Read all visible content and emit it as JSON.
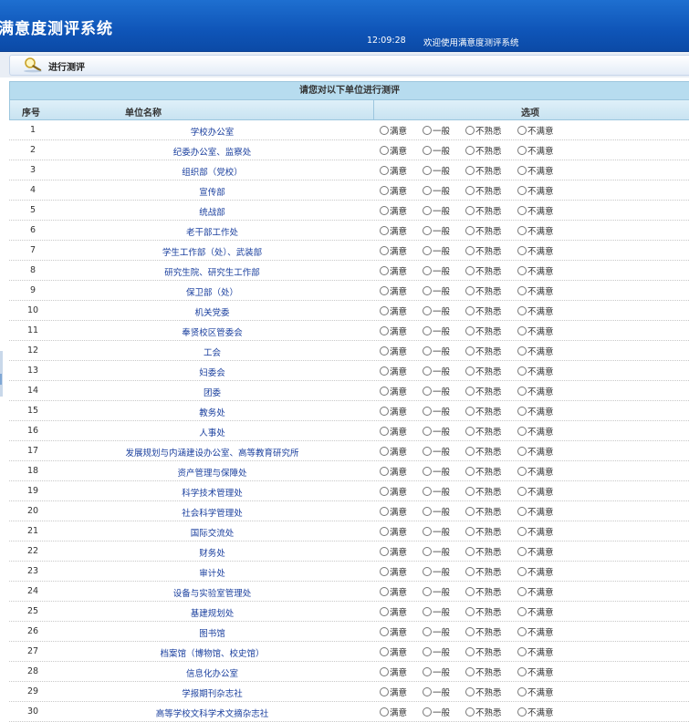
{
  "header": {
    "title": "满意度测评系统",
    "time": "12:09:28",
    "welcome": "欢迎使用满意度测评系统"
  },
  "tabbar": {
    "label": "进行测评",
    "icon": "magnifier-icon"
  },
  "table": {
    "caption": "请您对以下单位进行测评",
    "columns": {
      "seq": "序号",
      "name": "单位名称",
      "options": "选项"
    },
    "option_labels": [
      "满意",
      "一般",
      "不熟悉",
      "不满意"
    ],
    "rows": [
      {
        "seq": "1",
        "name": "学校办公室"
      },
      {
        "seq": "2",
        "name": "纪委办公室、监察处"
      },
      {
        "seq": "3",
        "name": "组织部（党校）"
      },
      {
        "seq": "4",
        "name": "宣传部"
      },
      {
        "seq": "5",
        "name": "统战部"
      },
      {
        "seq": "6",
        "name": "老干部工作处"
      },
      {
        "seq": "7",
        "name": "学生工作部（处）、武装部"
      },
      {
        "seq": "8",
        "name": "研究生院、研究生工作部"
      },
      {
        "seq": "9",
        "name": "保卫部（处）"
      },
      {
        "seq": "10",
        "name": "机关党委"
      },
      {
        "seq": "11",
        "name": "奉贤校区管委会"
      },
      {
        "seq": "12",
        "name": "工会"
      },
      {
        "seq": "13",
        "name": "妇委会"
      },
      {
        "seq": "14",
        "name": "团委"
      },
      {
        "seq": "15",
        "name": "教务处"
      },
      {
        "seq": "16",
        "name": "人事处"
      },
      {
        "seq": "17",
        "name": "发展规划与内涵建设办公室、高等教育研究所"
      },
      {
        "seq": "18",
        "name": "资产管理与保障处"
      },
      {
        "seq": "19",
        "name": "科学技术管理处"
      },
      {
        "seq": "20",
        "name": "社会科学管理处"
      },
      {
        "seq": "21",
        "name": "国际交流处"
      },
      {
        "seq": "22",
        "name": "财务处"
      },
      {
        "seq": "23",
        "name": "审计处"
      },
      {
        "seq": "24",
        "name": "设备与实验室管理处"
      },
      {
        "seq": "25",
        "name": "基建规划处"
      },
      {
        "seq": "26",
        "name": "图书馆"
      },
      {
        "seq": "27",
        "name": "档案馆（博物馆、校史馆）"
      },
      {
        "seq": "28",
        "name": "信息化办公室"
      },
      {
        "seq": "29",
        "name": "学报期刊杂志社"
      },
      {
        "seq": "30",
        "name": "高等学校文科学术文摘杂志社"
      }
    ]
  }
}
